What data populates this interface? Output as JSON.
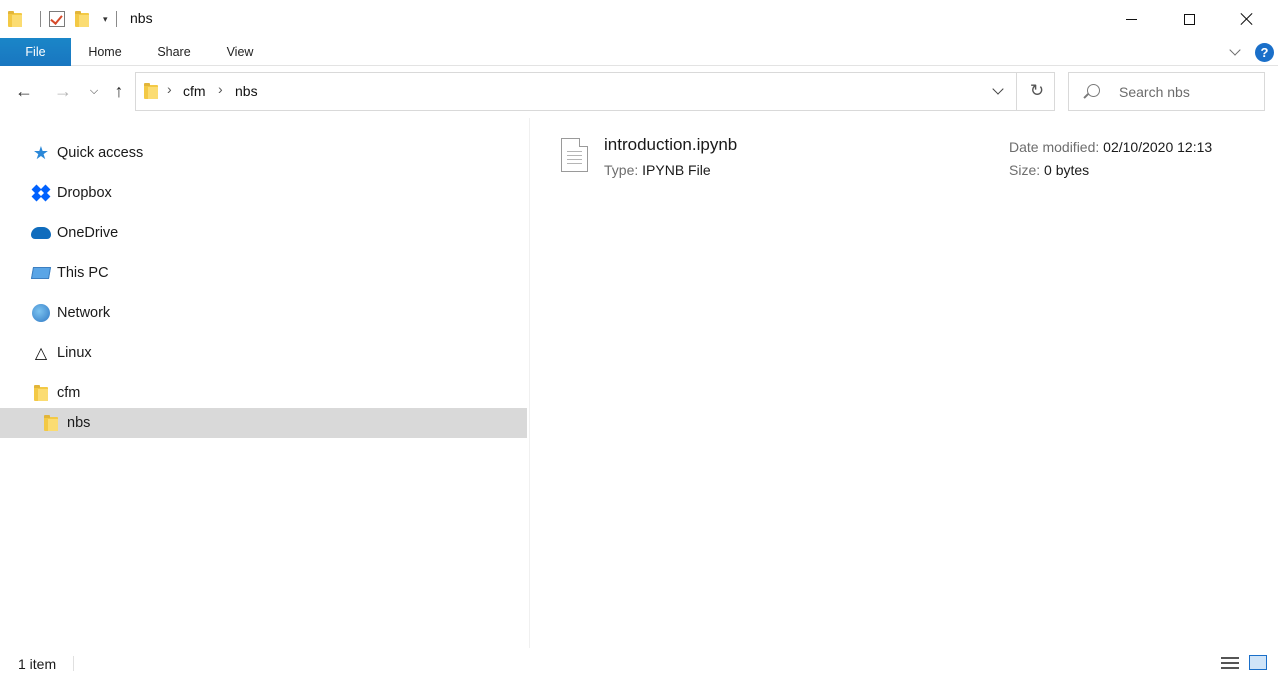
{
  "window": {
    "title": "nbs"
  },
  "ribbon": {
    "tabs": [
      {
        "label": "File",
        "active": true
      },
      {
        "label": "Home"
      },
      {
        "label": "Share"
      },
      {
        "label": "View"
      }
    ],
    "help": "?"
  },
  "navigation": {
    "breadcrumb": [
      "cfm",
      "nbs"
    ],
    "search_placeholder": "Search nbs",
    "refresh_glyph": "↻",
    "back_glyph": "←",
    "forward_glyph": "→",
    "up_glyph": "↑",
    "recent_glyph": "⌄"
  },
  "sidebar": {
    "items": [
      {
        "label": "Quick access",
        "icon": "star-icon"
      },
      {
        "label": "Dropbox",
        "icon": "dropbox-icon"
      },
      {
        "label": "OneDrive",
        "icon": "onedrive-icon"
      },
      {
        "label": "This PC",
        "icon": "pc-icon"
      },
      {
        "label": "Network",
        "icon": "network-icon"
      },
      {
        "label": "Linux",
        "icon": "linux-icon"
      },
      {
        "label": "cfm",
        "icon": "folder-icon"
      },
      {
        "label": "nbs",
        "icon": "folder-icon",
        "selected": true
      }
    ]
  },
  "files": [
    {
      "name": "introduction.ipynb",
      "type_label": "Type:",
      "type_value": "IPYNB File",
      "date_label": "Date modified:",
      "date_value": "02/10/2020 12:13",
      "size_label": "Size:",
      "size_value": "0 bytes"
    }
  ],
  "status": {
    "item_count": "1 item"
  },
  "colors": {
    "file_tab": "#1979ca",
    "selection": "#d9d9d9",
    "folder": "#f3c945"
  }
}
